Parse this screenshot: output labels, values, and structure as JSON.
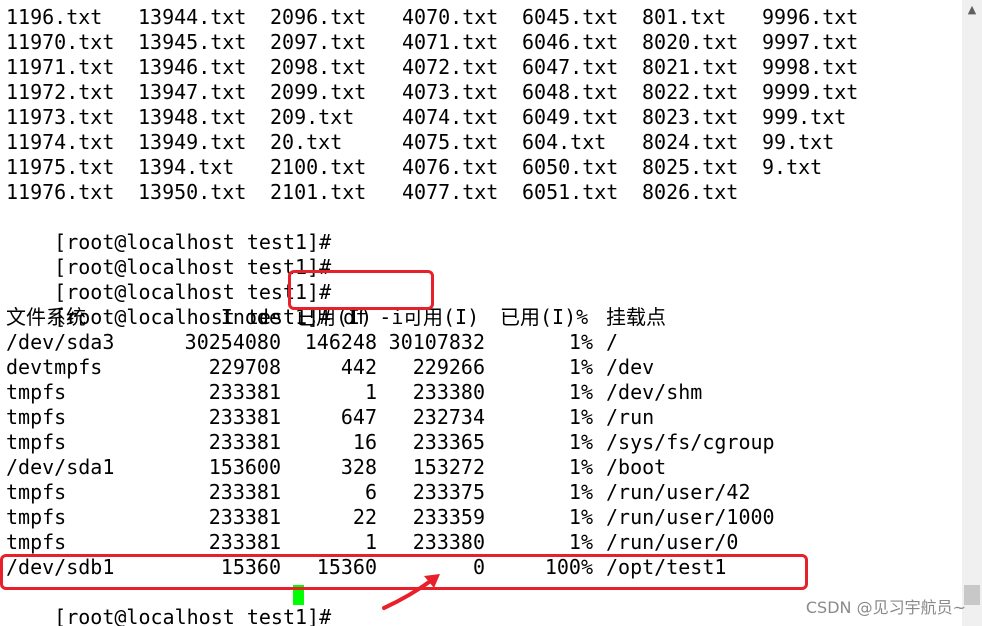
{
  "file_rows": [
    [
      "1196.txt",
      "13944.txt",
      "2096.txt",
      "4070.txt",
      "6045.txt",
      "801.txt",
      "9996.txt"
    ],
    [
      "11970.txt",
      "13945.txt",
      "2097.txt",
      "4071.txt",
      "6046.txt",
      "8020.txt",
      "9997.txt"
    ],
    [
      "11971.txt",
      "13946.txt",
      "2098.txt",
      "4072.txt",
      "6047.txt",
      "8021.txt",
      "9998.txt"
    ],
    [
      "11972.txt",
      "13947.txt",
      "2099.txt",
      "4073.txt",
      "6048.txt",
      "8022.txt",
      "9999.txt"
    ],
    [
      "11973.txt",
      "13948.txt",
      "209.txt",
      "4074.txt",
      "6049.txt",
      "8023.txt",
      "999.txt"
    ],
    [
      "11974.txt",
      "13949.txt",
      "20.txt",
      "4075.txt",
      "604.txt",
      "8024.txt",
      "99.txt"
    ],
    [
      "11975.txt",
      "1394.txt",
      "2100.txt",
      "4076.txt",
      "6050.txt",
      "8025.txt",
      "9.txt"
    ],
    [
      "11976.txt",
      "13950.txt",
      "2101.txt",
      "4077.txt",
      "6051.txt",
      "8026.txt",
      ""
    ]
  ],
  "prompt": "[root@localhost test1]# ",
  "command": "df -i",
  "df_header": {
    "filesystem": "文件系统",
    "inodes": "Inode",
    "used": "已用(I)",
    "free": "可用(I)",
    "use_pct": "已用(I)%",
    "mount": "挂载点"
  },
  "df_rows": [
    {
      "fs": "/dev/sda3",
      "inodes": "30254080",
      "used": "146248",
      "free": "30107832",
      "pct": "1%",
      "mount": "/"
    },
    {
      "fs": "devtmpfs",
      "inodes": "229708",
      "used": "442",
      "free": "229266",
      "pct": "1%",
      "mount": "/dev"
    },
    {
      "fs": "tmpfs",
      "inodes": "233381",
      "used": "1",
      "free": "233380",
      "pct": "1%",
      "mount": "/dev/shm"
    },
    {
      "fs": "tmpfs",
      "inodes": "233381",
      "used": "647",
      "free": "232734",
      "pct": "1%",
      "mount": "/run"
    },
    {
      "fs": "tmpfs",
      "inodes": "233381",
      "used": "16",
      "free": "233365",
      "pct": "1%",
      "mount": "/sys/fs/cgroup"
    },
    {
      "fs": "/dev/sda1",
      "inodes": "153600",
      "used": "328",
      "free": "153272",
      "pct": "1%",
      "mount": "/boot"
    },
    {
      "fs": "tmpfs",
      "inodes": "233381",
      "used": "6",
      "free": "233375",
      "pct": "1%",
      "mount": "/run/user/42"
    },
    {
      "fs": "tmpfs",
      "inodes": "233381",
      "used": "22",
      "free": "233359",
      "pct": "1%",
      "mount": "/run/user/1000"
    },
    {
      "fs": "tmpfs",
      "inodes": "233381",
      "used": "1",
      "free": "233380",
      "pct": "1%",
      "mount": "/run/user/0"
    },
    {
      "fs": "/dev/sdb1",
      "inodes": "15360",
      "used": "15360",
      "free": "0",
      "pct": "100%",
      "mount": "/opt/test1"
    }
  ],
  "watermark": "CSDN @见习宇航员~",
  "colors": {
    "background": "#ffffff",
    "text": "#000000",
    "cursor": "#00ff00",
    "annotation": "#e8202a"
  }
}
